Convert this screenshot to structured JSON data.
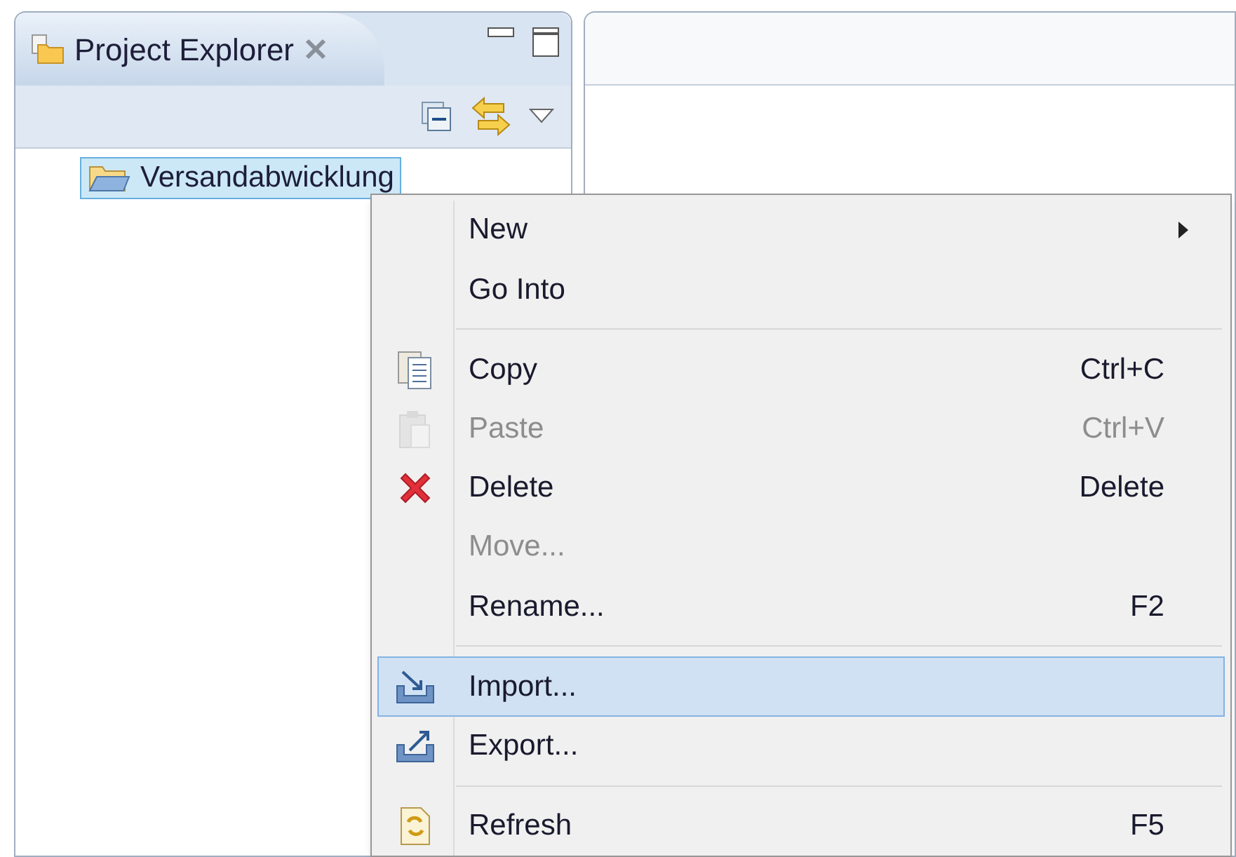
{
  "explorer": {
    "title": "Project Explorer",
    "tree": [
      {
        "label": "Versandabwicklung",
        "selected": true
      }
    ]
  },
  "context_menu": {
    "items": [
      {
        "kind": "item",
        "label": "New",
        "submenu": true,
        "disabled": false,
        "selected": false
      },
      {
        "kind": "item",
        "label": "Go Into",
        "submenu": false,
        "disabled": false,
        "selected": false
      },
      {
        "kind": "separator"
      },
      {
        "kind": "item",
        "label": "Copy",
        "shortcut": "Ctrl+C",
        "submenu": false,
        "disabled": false,
        "selected": false
      },
      {
        "kind": "item",
        "label": "Paste",
        "shortcut": "Ctrl+V",
        "submenu": false,
        "disabled": true,
        "selected": false
      },
      {
        "kind": "item",
        "label": "Delete",
        "shortcut": "Delete",
        "submenu": false,
        "disabled": false,
        "selected": false
      },
      {
        "kind": "item",
        "label": "Move...",
        "submenu": false,
        "disabled": true,
        "selected": false
      },
      {
        "kind": "item",
        "label": "Rename...",
        "shortcut": "F2",
        "submenu": false,
        "disabled": false,
        "selected": false
      },
      {
        "kind": "separator"
      },
      {
        "kind": "item",
        "label": "Import...",
        "submenu": false,
        "disabled": false,
        "selected": true
      },
      {
        "kind": "item",
        "label": "Export...",
        "submenu": false,
        "disabled": false,
        "selected": false
      },
      {
        "kind": "separator"
      },
      {
        "kind": "item",
        "label": "Refresh",
        "shortcut": "F5",
        "submenu": false,
        "disabled": false,
        "selected": false
      }
    ]
  }
}
